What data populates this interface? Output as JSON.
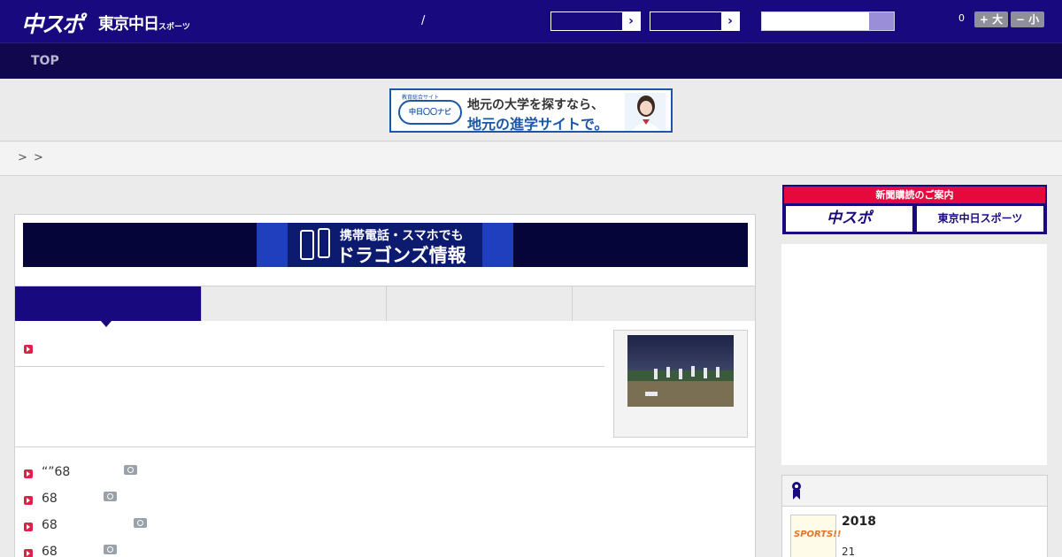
{
  "header": {
    "logo_main": "中スポ",
    "logo_sub": "東京中日",
    "logo_sub_small": "スポーツ",
    "slash": "/",
    "font_count": "0",
    "font_increase": "+ 大",
    "font_decrease": "− 小",
    "select_arrow": "›"
  },
  "nav": {
    "top": "TOP"
  },
  "ad": {
    "tagline": "教育総合サイト",
    "badge": "中日〇〇ナビ",
    "line1": "地元の大学を探すなら、",
    "line2": "地元の進学サイトで。"
  },
  "breadcrumb": {
    "sep1": ">",
    "sep2": ">"
  },
  "dragons_banner": {
    "line1": "携帯電話・スマホでも",
    "line2": "ドラゴンズ情報"
  },
  "news": [
    {
      "text": "“”68"
    },
    {
      "text": "68"
    },
    {
      "text": "68"
    },
    {
      "text": "68"
    }
  ],
  "sidebar": {
    "subscribe_header": "新聞購読のご案内",
    "subscribe_btn1": "中スポ",
    "subscribe_btn2": "東京中日スポーツ",
    "ranking_year": "2018",
    "ranking_num": "21",
    "ranking_img_text": "SPORTS!!"
  },
  "colors": {
    "brand": "#180a7e",
    "accent": "#e1204a",
    "subscribe": "#e60a3c"
  }
}
